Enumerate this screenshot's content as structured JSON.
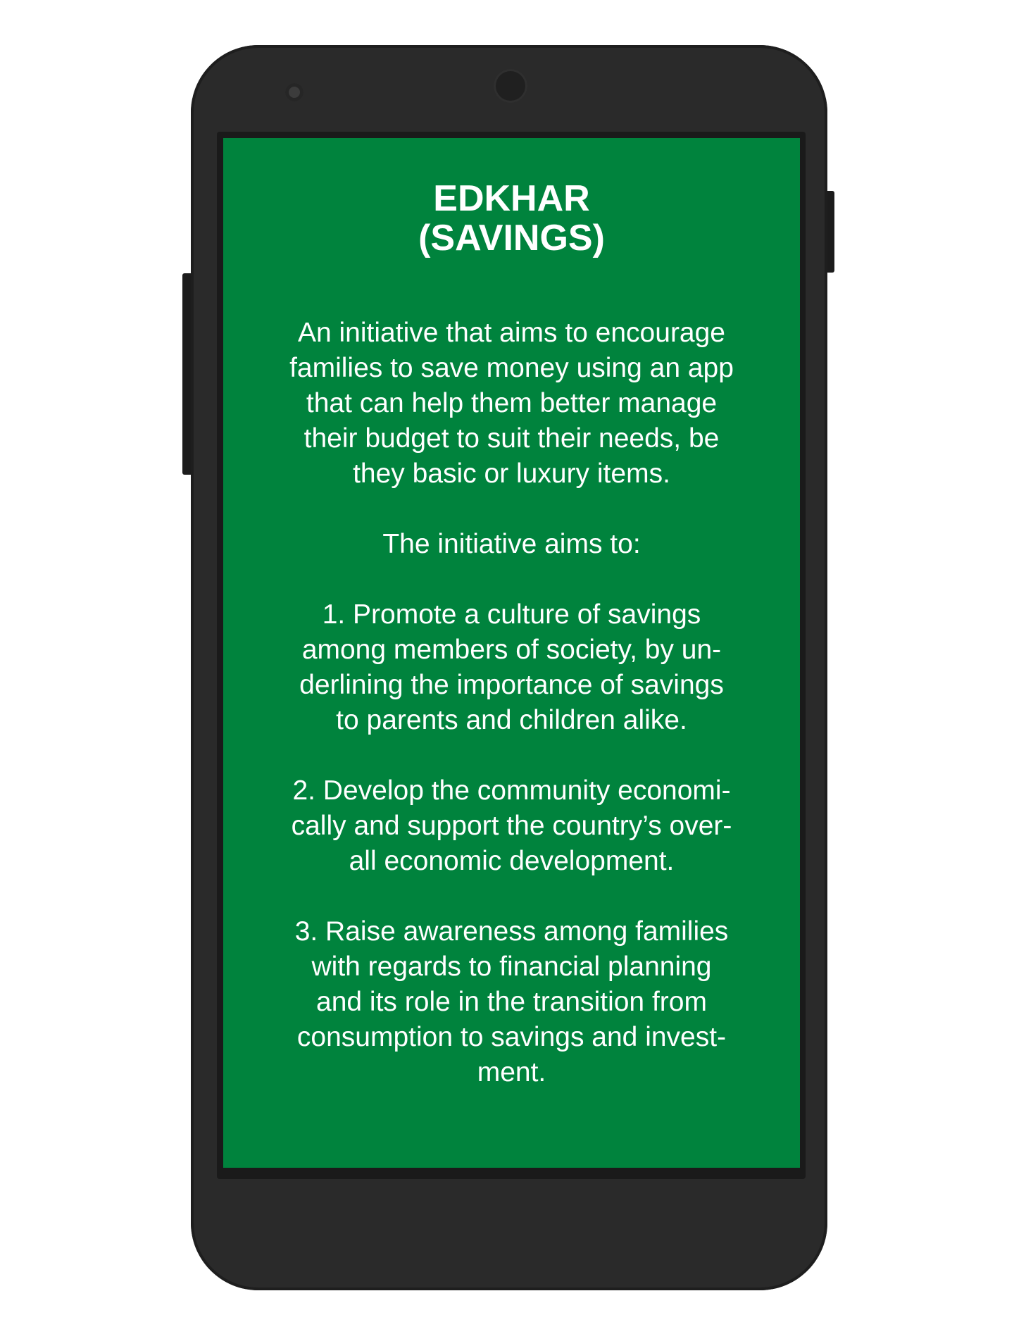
{
  "screen": {
    "background_color": "#00833d",
    "text_color": "#ffffff",
    "title_line1": "EDKHAR",
    "title_line2": "(SAVINGS)",
    "intro": [
      "An initiative that aims to encourage",
      "families to save money using an app",
      "that can help them better manage",
      "their budget to suit their needs, be",
      "they basic or luxury items."
    ],
    "aims_heading": "The initiative aims to:",
    "aim1": [
      "1. Promote a culture of savings",
      "among members of society, by un-",
      "derlining the importance of savings",
      "to parents and children alike."
    ],
    "aim2": [
      "2. Develop the community economi-",
      "cally and support the country’s over-",
      "all economic development."
    ],
    "aim3": [
      "3. Raise awareness among families",
      "with regards to financial planning",
      "and its role in the transition from",
      "consumption to savings and invest-",
      "ment."
    ]
  },
  "device": {
    "body_color": "#2a2a2a"
  }
}
